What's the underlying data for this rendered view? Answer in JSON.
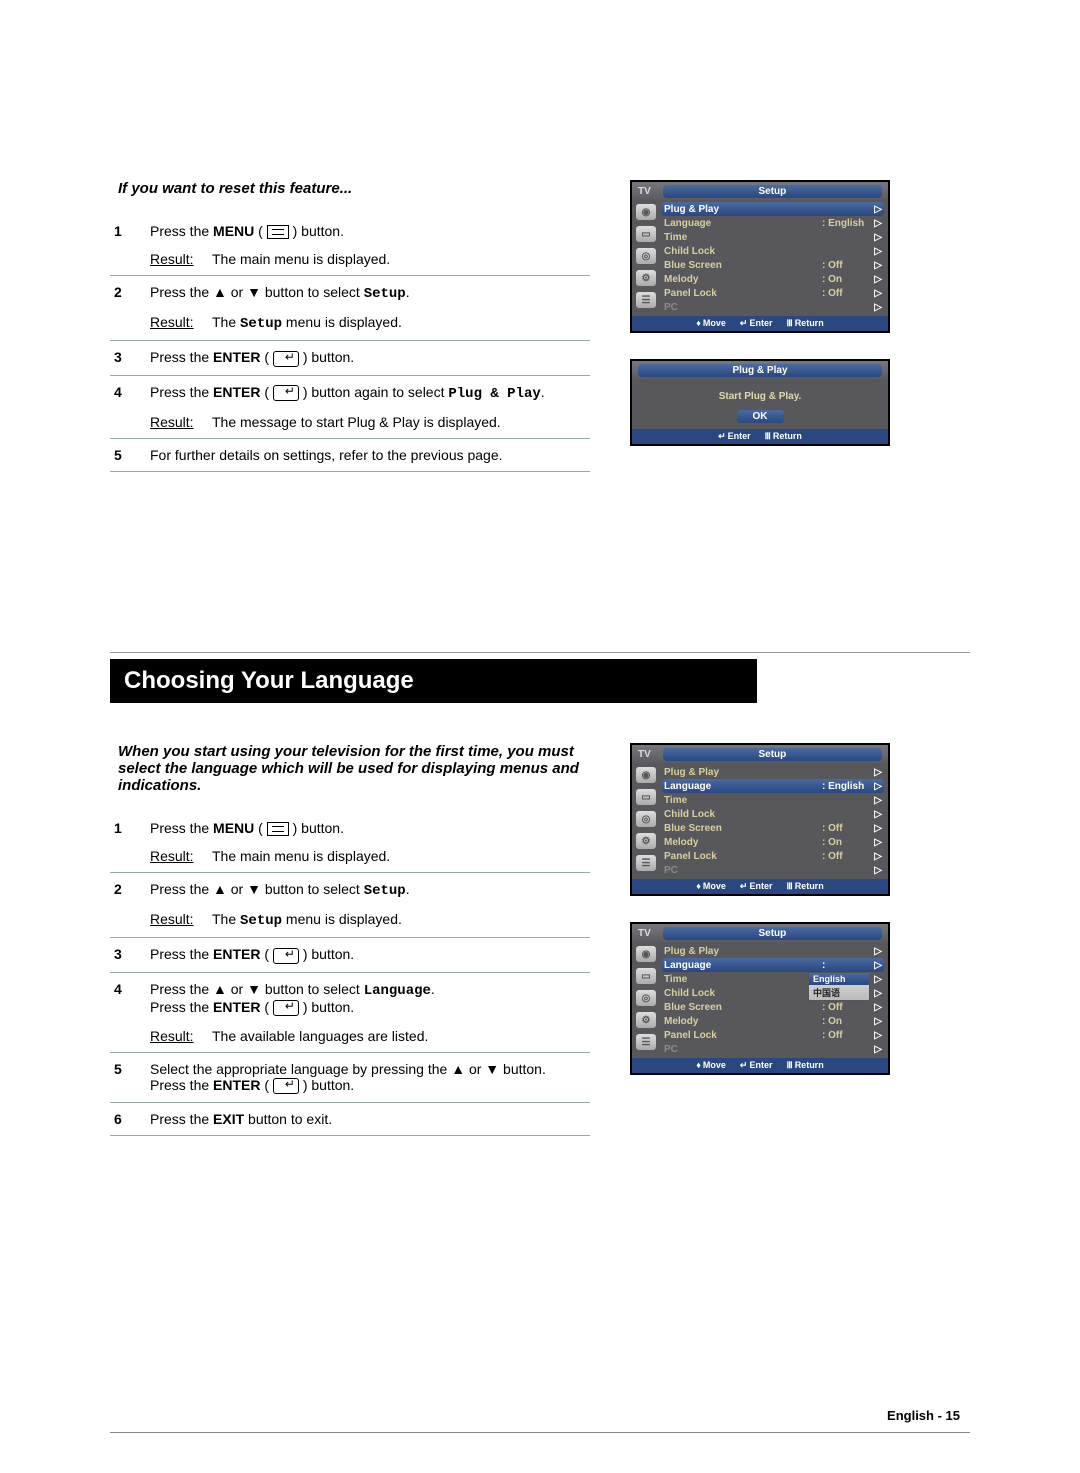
{
  "section1": {
    "intro": "If you want to reset this feature...",
    "steps": [
      {
        "num": "1",
        "line1_pre": "Press the ",
        "line1_bold": "MENU",
        "line1_post": " button.",
        "result": "The main menu is displayed.",
        "icon": "menu"
      },
      {
        "num": "2",
        "line1": "Press the ▲ or ▼ button to select ",
        "line1_mono": "Setup",
        "line1_post2": ".",
        "result_pre": "The ",
        "result_mono": "Setup",
        "result_post": " menu is displayed."
      },
      {
        "num": "3",
        "line1_pre": "Press the ",
        "line1_bold": "ENTER",
        "line1_post": " button.",
        "icon": "enter"
      },
      {
        "num": "4",
        "line1_pre": "Press the ",
        "line1_bold": "ENTER",
        "line1_post": " button again to select ",
        "line1_mono": "Plug & Play",
        "line1_post2": ".",
        "result": "The message to start Plug & Play is displayed.",
        "icon": "enter"
      },
      {
        "num": "5",
        "line1": "For further details on settings, refer to the previous page."
      }
    ]
  },
  "section_title": "Choosing Your Language",
  "section2": {
    "intro": "When you start using your television for the first time, you must select the language which will be used for displaying menus and indications.",
    "steps": [
      {
        "num": "1",
        "line1_pre": "Press the ",
        "line1_bold": "MENU",
        "line1_post": " button.",
        "result": "The main menu is displayed.",
        "icon": "menu"
      },
      {
        "num": "2",
        "line1": "Press the ▲ or ▼ button to select ",
        "line1_mono": "Setup",
        "line1_post2": ".",
        "result_pre": "The ",
        "result_mono": "Setup",
        "result_post": " menu is displayed."
      },
      {
        "num": "3",
        "line1_pre": "Press the ",
        "line1_bold": "ENTER",
        "line1_post": " button.",
        "icon": "enter"
      },
      {
        "num": "4",
        "line1": "Press the ▲ or ▼ button to select ",
        "line1_mono": "Language",
        "line1_post2": ".",
        "line2_pre": "Press the ",
        "line2_bold": "ENTER",
        "line2_post": " button.",
        "icon2": "enter",
        "result": "The available languages are listed."
      },
      {
        "num": "5",
        "line1": "Select the appropriate language by pressing the ▲ or ▼ button.",
        "line2_pre": "Press the ",
        "line2_bold": "ENTER",
        "line2_post": " button.",
        "icon2": "enter"
      },
      {
        "num": "6",
        "line1_pre": "Press the ",
        "line1_bold": "EXIT",
        "line1_post": " button to exit."
      }
    ]
  },
  "osd_setup": {
    "tv": "TV",
    "title": "Setup",
    "items": [
      {
        "label": "Plug & Play",
        "val": "",
        "selected": true
      },
      {
        "label": "Language",
        "val": ": English"
      },
      {
        "label": "Time",
        "val": ""
      },
      {
        "label": "Child Lock",
        "val": ""
      },
      {
        "label": "Blue Screen",
        "val": ": Off"
      },
      {
        "label": "Melody",
        "val": ": On"
      },
      {
        "label": "Panel Lock",
        "val": ": Off"
      },
      {
        "label": "PC",
        "val": "",
        "disabled": true
      }
    ],
    "footer": {
      "move": "Move",
      "enter": "Enter",
      "return": "Return"
    }
  },
  "osd_plugplay": {
    "title": "Plug & Play",
    "msg": "Start Plug & Play.",
    "ok": "OK",
    "footer": {
      "enter": "Enter",
      "return": "Return"
    }
  },
  "osd_setup_lang": {
    "tv": "TV",
    "title": "Setup",
    "items": [
      {
        "label": "Plug & Play",
        "val": ""
      },
      {
        "label": "Language",
        "val": ": English",
        "selected": true
      },
      {
        "label": "Time",
        "val": ""
      },
      {
        "label": "Child Lock",
        "val": ""
      },
      {
        "label": "Blue Screen",
        "val": ": Off"
      },
      {
        "label": "Melody",
        "val": ": On"
      },
      {
        "label": "Panel Lock",
        "val": ": Off"
      },
      {
        "label": "PC",
        "val": "",
        "disabled": true
      }
    ],
    "footer": {
      "move": "Move",
      "enter": "Enter",
      "return": "Return"
    }
  },
  "osd_setup_langopen": {
    "tv": "TV",
    "title": "Setup",
    "items": [
      {
        "label": "Plug & Play",
        "val": ""
      },
      {
        "label": "Language",
        "val": ":",
        "selected": true
      },
      {
        "label": "Time",
        "val": ""
      },
      {
        "label": "Child Lock",
        "val": ""
      },
      {
        "label": "Blue Screen",
        "val": ": Off"
      },
      {
        "label": "Melody",
        "val": ": On"
      },
      {
        "label": "Panel Lock",
        "val": ": Off"
      },
      {
        "label": "PC",
        "val": "",
        "disabled": true
      }
    ],
    "dropdown": [
      {
        "label": "English",
        "selected": true
      },
      {
        "label": "中国语"
      }
    ],
    "footer": {
      "move": "Move",
      "enter": "Enter",
      "return": "Return"
    }
  },
  "page_footer": "English - 15"
}
